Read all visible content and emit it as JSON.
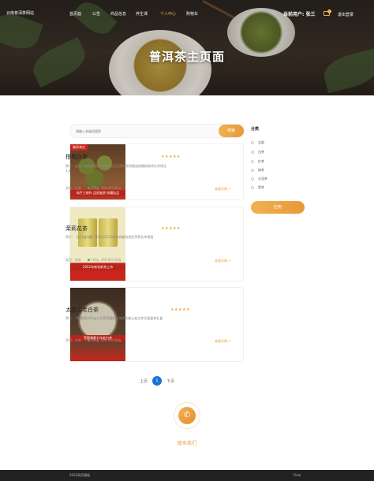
{
  "header": {
    "logo": "云南普洱茶网站",
    "nav": [
      "首页面",
      "公告",
      "商品信息",
      "养生课",
      "个人中心",
      "购物车"
    ],
    "active_index": 4,
    "user_label": "当前用户: 张三",
    "logout": "退出登录"
  },
  "hero": {
    "title": "普洱茶主页面"
  },
  "search": {
    "placeholder": "请输入关键词搜索",
    "button": "搜索"
  },
  "products": [
    {
      "name": "柑橘白茶",
      "rating": 5,
      "desc": "简介：南方小青柑精选枸橘柑皮胶汩乃原料采用精选柑橘柑和鸿头茶饼比 1.6",
      "category": "类型：白茶",
      "weight": "100g",
      "price": "399.00/100g",
      "detail_label": "查看详情",
      "img_tag": "袖珍茶庄",
      "img_caption": "纯手工制作 品质鉴赏 收藏佳品"
    },
    {
      "name": "茉莉花茶",
      "rating": 5,
      "desc": "简介：【买1盒2罐】茉莉花2022新茶特级浓香型茉莉花茶银毫",
      "category": "类型：绿茶",
      "weight": "100g",
      "price": "399.00/100g",
      "detail_label": "查看详情",
      "img_tag": "",
      "img_caption": "2022年新花新茶上市"
    },
    {
      "name": "太姥山老白茶",
      "rating": 5,
      "desc": "简介：7饼整提2450g七年荒野福鼎白茶野太姥山老白茶贡眉盒装礼盒",
      "category": "类型：白茶",
      "weight": "100g",
      "price": "399.00/100g",
      "detail_label": "查看详情",
      "img_tag": "",
      "img_caption": "荒野福鼎七年老白茶"
    }
  ],
  "sidebar": {
    "title": "分类",
    "categories": [
      "全部",
      "白茶",
      "红茶",
      "绿茶",
      "乌龙茶",
      "黑茶"
    ],
    "apply": "应用"
  },
  "pagination": {
    "prev": "上页",
    "current": "1",
    "next": "下页"
  },
  "contact": {
    "label": "联系我们"
  },
  "footer": {
    "left": "2022网页模板",
    "right": "Final"
  },
  "colors": {
    "accent": "#e89a3a",
    "page_active": "#1a73d9",
    "footer": "#222222"
  }
}
